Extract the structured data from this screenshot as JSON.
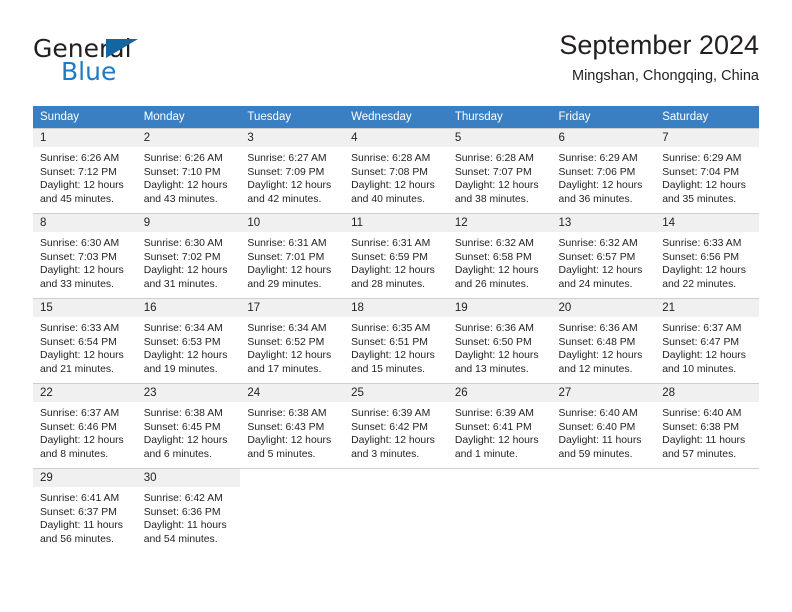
{
  "brand": {
    "name_top": "General",
    "name_bottom": "Blue",
    "triangle_color": "#15659e",
    "accent_color": "#1f7ac4"
  },
  "header": {
    "title": "September 2024",
    "subtitle": "Mingshan, Chongqing, China"
  },
  "theme": {
    "header_row_bg": "#3a7fc1",
    "daynum_band_bg": "#f0f0f0",
    "grid_line": "#cfcfcf",
    "text": "#231f20"
  },
  "weekday_headers": [
    "Sunday",
    "Monday",
    "Tuesday",
    "Wednesday",
    "Thursday",
    "Friday",
    "Saturday"
  ],
  "weeks": [
    [
      {
        "day": "1",
        "sunrise": "Sunrise: 6:26 AM",
        "sunset": "Sunset: 7:12 PM",
        "daylight1": "Daylight: 12 hours",
        "daylight2": "and 45 minutes."
      },
      {
        "day": "2",
        "sunrise": "Sunrise: 6:26 AM",
        "sunset": "Sunset: 7:10 PM",
        "daylight1": "Daylight: 12 hours",
        "daylight2": "and 43 minutes."
      },
      {
        "day": "3",
        "sunrise": "Sunrise: 6:27 AM",
        "sunset": "Sunset: 7:09 PM",
        "daylight1": "Daylight: 12 hours",
        "daylight2": "and 42 minutes."
      },
      {
        "day": "4",
        "sunrise": "Sunrise: 6:28 AM",
        "sunset": "Sunset: 7:08 PM",
        "daylight1": "Daylight: 12 hours",
        "daylight2": "and 40 minutes."
      },
      {
        "day": "5",
        "sunrise": "Sunrise: 6:28 AM",
        "sunset": "Sunset: 7:07 PM",
        "daylight1": "Daylight: 12 hours",
        "daylight2": "and 38 minutes."
      },
      {
        "day": "6",
        "sunrise": "Sunrise: 6:29 AM",
        "sunset": "Sunset: 7:06 PM",
        "daylight1": "Daylight: 12 hours",
        "daylight2": "and 36 minutes."
      },
      {
        "day": "7",
        "sunrise": "Sunrise: 6:29 AM",
        "sunset": "Sunset: 7:04 PM",
        "daylight1": "Daylight: 12 hours",
        "daylight2": "and 35 minutes."
      }
    ],
    [
      {
        "day": "8",
        "sunrise": "Sunrise: 6:30 AM",
        "sunset": "Sunset: 7:03 PM",
        "daylight1": "Daylight: 12 hours",
        "daylight2": "and 33 minutes."
      },
      {
        "day": "9",
        "sunrise": "Sunrise: 6:30 AM",
        "sunset": "Sunset: 7:02 PM",
        "daylight1": "Daylight: 12 hours",
        "daylight2": "and 31 minutes."
      },
      {
        "day": "10",
        "sunrise": "Sunrise: 6:31 AM",
        "sunset": "Sunset: 7:01 PM",
        "daylight1": "Daylight: 12 hours",
        "daylight2": "and 29 minutes."
      },
      {
        "day": "11",
        "sunrise": "Sunrise: 6:31 AM",
        "sunset": "Sunset: 6:59 PM",
        "daylight1": "Daylight: 12 hours",
        "daylight2": "and 28 minutes."
      },
      {
        "day": "12",
        "sunrise": "Sunrise: 6:32 AM",
        "sunset": "Sunset: 6:58 PM",
        "daylight1": "Daylight: 12 hours",
        "daylight2": "and 26 minutes."
      },
      {
        "day": "13",
        "sunrise": "Sunrise: 6:32 AM",
        "sunset": "Sunset: 6:57 PM",
        "daylight1": "Daylight: 12 hours",
        "daylight2": "and 24 minutes."
      },
      {
        "day": "14",
        "sunrise": "Sunrise: 6:33 AM",
        "sunset": "Sunset: 6:56 PM",
        "daylight1": "Daylight: 12 hours",
        "daylight2": "and 22 minutes."
      }
    ],
    [
      {
        "day": "15",
        "sunrise": "Sunrise: 6:33 AM",
        "sunset": "Sunset: 6:54 PM",
        "daylight1": "Daylight: 12 hours",
        "daylight2": "and 21 minutes."
      },
      {
        "day": "16",
        "sunrise": "Sunrise: 6:34 AM",
        "sunset": "Sunset: 6:53 PM",
        "daylight1": "Daylight: 12 hours",
        "daylight2": "and 19 minutes."
      },
      {
        "day": "17",
        "sunrise": "Sunrise: 6:34 AM",
        "sunset": "Sunset: 6:52 PM",
        "daylight1": "Daylight: 12 hours",
        "daylight2": "and 17 minutes."
      },
      {
        "day": "18",
        "sunrise": "Sunrise: 6:35 AM",
        "sunset": "Sunset: 6:51 PM",
        "daylight1": "Daylight: 12 hours",
        "daylight2": "and 15 minutes."
      },
      {
        "day": "19",
        "sunrise": "Sunrise: 6:36 AM",
        "sunset": "Sunset: 6:50 PM",
        "daylight1": "Daylight: 12 hours",
        "daylight2": "and 13 minutes."
      },
      {
        "day": "20",
        "sunrise": "Sunrise: 6:36 AM",
        "sunset": "Sunset: 6:48 PM",
        "daylight1": "Daylight: 12 hours",
        "daylight2": "and 12 minutes."
      },
      {
        "day": "21",
        "sunrise": "Sunrise: 6:37 AM",
        "sunset": "Sunset: 6:47 PM",
        "daylight1": "Daylight: 12 hours",
        "daylight2": "and 10 minutes."
      }
    ],
    [
      {
        "day": "22",
        "sunrise": "Sunrise: 6:37 AM",
        "sunset": "Sunset: 6:46 PM",
        "daylight1": "Daylight: 12 hours",
        "daylight2": "and 8 minutes."
      },
      {
        "day": "23",
        "sunrise": "Sunrise: 6:38 AM",
        "sunset": "Sunset: 6:45 PM",
        "daylight1": "Daylight: 12 hours",
        "daylight2": "and 6 minutes."
      },
      {
        "day": "24",
        "sunrise": "Sunrise: 6:38 AM",
        "sunset": "Sunset: 6:43 PM",
        "daylight1": "Daylight: 12 hours",
        "daylight2": "and 5 minutes."
      },
      {
        "day": "25",
        "sunrise": "Sunrise: 6:39 AM",
        "sunset": "Sunset: 6:42 PM",
        "daylight1": "Daylight: 12 hours",
        "daylight2": "and 3 minutes."
      },
      {
        "day": "26",
        "sunrise": "Sunrise: 6:39 AM",
        "sunset": "Sunset: 6:41 PM",
        "daylight1": "Daylight: 12 hours",
        "daylight2": "and 1 minute."
      },
      {
        "day": "27",
        "sunrise": "Sunrise: 6:40 AM",
        "sunset": "Sunset: 6:40 PM",
        "daylight1": "Daylight: 11 hours",
        "daylight2": "and 59 minutes."
      },
      {
        "day": "28",
        "sunrise": "Sunrise: 6:40 AM",
        "sunset": "Sunset: 6:38 PM",
        "daylight1": "Daylight: 11 hours",
        "daylight2": "and 57 minutes."
      }
    ],
    [
      {
        "day": "29",
        "sunrise": "Sunrise: 6:41 AM",
        "sunset": "Sunset: 6:37 PM",
        "daylight1": "Daylight: 11 hours",
        "daylight2": "and 56 minutes."
      },
      {
        "day": "30",
        "sunrise": "Sunrise: 6:42 AM",
        "sunset": "Sunset: 6:36 PM",
        "daylight1": "Daylight: 11 hours",
        "daylight2": "and 54 minutes."
      },
      {
        "day": "",
        "sunrise": "",
        "sunset": "",
        "daylight1": "",
        "daylight2": ""
      },
      {
        "day": "",
        "sunrise": "",
        "sunset": "",
        "daylight1": "",
        "daylight2": ""
      },
      {
        "day": "",
        "sunrise": "",
        "sunset": "",
        "daylight1": "",
        "daylight2": ""
      },
      {
        "day": "",
        "sunrise": "",
        "sunset": "",
        "daylight1": "",
        "daylight2": ""
      },
      {
        "day": "",
        "sunrise": "",
        "sunset": "",
        "daylight1": "",
        "daylight2": ""
      }
    ]
  ]
}
